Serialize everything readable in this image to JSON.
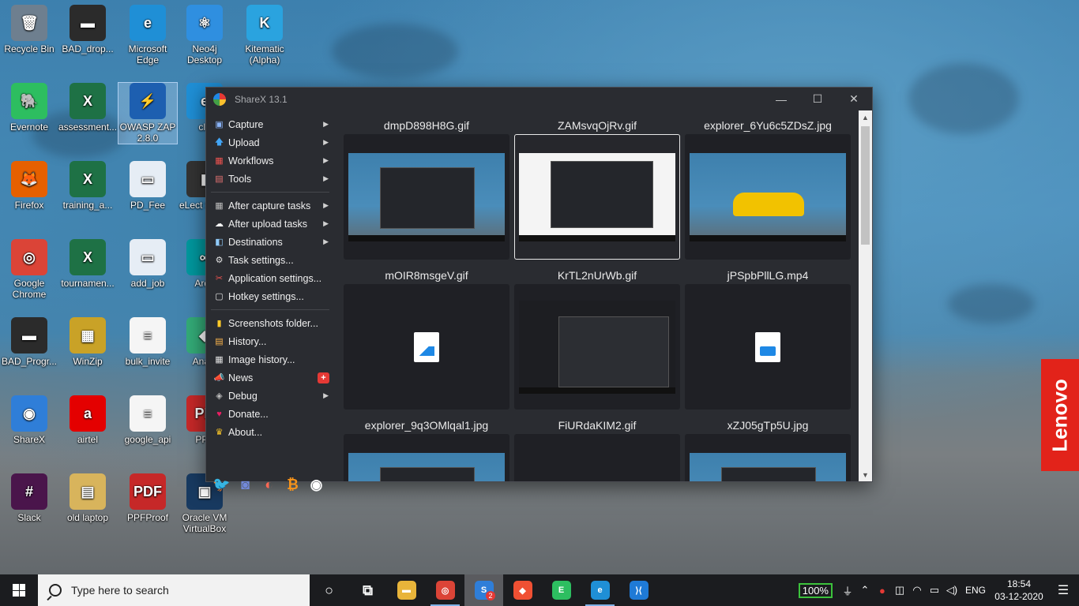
{
  "desktop": {
    "icons": [
      {
        "label": "Recycle Bin",
        "color": "#6e7f8f",
        "glyph": "🗑"
      },
      {
        "label": "BAD_drop...",
        "color": "#2b2b2b",
        "glyph": "▬"
      },
      {
        "label": "Microsoft Edge",
        "color": "#1f8fd6",
        "glyph": "e"
      },
      {
        "label": "Neo4j Desktop",
        "color": "#2f8fe0",
        "glyph": "⚛"
      },
      {
        "label": "Kitematic (Alpha)",
        "color": "#2aa3df",
        "glyph": "K"
      },
      {
        "label": "Evernote",
        "color": "#2dbe60",
        "glyph": "🐘"
      },
      {
        "label": "assessment...",
        "color": "#1e7145",
        "glyph": "X"
      },
      {
        "label": "OWASP ZAP 2.8.0",
        "color": "#1d5fb0",
        "glyph": "⚡"
      },
      {
        "label": "cla",
        "color": "#1f8fd6",
        "glyph": "e"
      },
      {
        "label": "Firefox",
        "color": "#e66000",
        "glyph": "🦊"
      },
      {
        "label": "training_a...",
        "color": "#1e7145",
        "glyph": "X"
      },
      {
        "label": "PD_Fee",
        "color": "#e6edf5",
        "glyph": "▭"
      },
      {
        "label": "eLect Scree",
        "color": "#333",
        "glyph": "▮"
      },
      {
        "label": "Google Chrome",
        "color": "#db4437",
        "glyph": "◎"
      },
      {
        "label": "tournamen...",
        "color": "#1e7145",
        "glyph": "X"
      },
      {
        "label": "add_job",
        "color": "#e6edf5",
        "glyph": "▭"
      },
      {
        "label": "Ardu",
        "color": "#00979d",
        "glyph": "∞"
      },
      {
        "label": "BAD_Progr...",
        "color": "#2b2b2b",
        "glyph": "▬"
      },
      {
        "label": "WinZip",
        "color": "#c9a227",
        "glyph": "▦"
      },
      {
        "label": "bulk_invite",
        "color": "#f5f5f5",
        "glyph": "≡"
      },
      {
        "label": "Analo",
        "color": "#3a7",
        "glyph": "◆"
      },
      {
        "label": "ShareX",
        "color": "#2f7ed8",
        "glyph": "◉"
      },
      {
        "label": "airtel",
        "color": "#e40000",
        "glyph": "a"
      },
      {
        "label": "google_api",
        "color": "#f5f5f5",
        "glyph": "≡"
      },
      {
        "label": "PPF",
        "color": "#c62828",
        "glyph": "PD"
      },
      {
        "label": "Slack",
        "color": "#4a154b",
        "glyph": "#"
      },
      {
        "label": "old laptop",
        "color": "#d8b45c",
        "glyph": "▤"
      },
      {
        "label": "PPFProof",
        "color": "#c62828",
        "glyph": "PDF"
      },
      {
        "label": "Oracle VM VirtualBox",
        "color": "#183a61",
        "glyph": "▣"
      }
    ]
  },
  "sharex": {
    "title": "ShareX 13.1",
    "controls": {
      "minimize": "—",
      "maximize": "☐",
      "close": "✕"
    },
    "menu_top": [
      {
        "label": "Capture",
        "icon": "▣",
        "color": "#8ab4f8",
        "submenu": true
      },
      {
        "label": "Upload",
        "icon": "🡅",
        "color": "#42a5f5",
        "submenu": true
      },
      {
        "label": "Workflows",
        "icon": "▦",
        "color": "#ef5350",
        "submenu": true
      },
      {
        "label": "Tools",
        "icon": "▤",
        "color": "#e57373",
        "submenu": true
      }
    ],
    "menu_mid": [
      {
        "label": "After capture tasks",
        "icon": "▦",
        "color": "#bdbdbd",
        "submenu": true
      },
      {
        "label": "After upload tasks",
        "icon": "☁",
        "color": "#ffffff",
        "submenu": true
      },
      {
        "label": "Destinations",
        "icon": "◧",
        "color": "#90caf9",
        "submenu": true
      },
      {
        "label": "Task settings...",
        "icon": "⚙",
        "color": "#e0e0e0",
        "submenu": false
      },
      {
        "label": "Application settings...",
        "icon": "✂",
        "color": "#ef5350",
        "submenu": false
      },
      {
        "label": "Hotkey settings...",
        "icon": "▢",
        "color": "#e0e0e0",
        "submenu": false
      }
    ],
    "menu_bottom": [
      {
        "label": "Screenshots folder...",
        "icon": "▮",
        "color": "#ffca28",
        "submenu": false
      },
      {
        "label": "History...",
        "icon": "▤",
        "color": "#ffb74d",
        "submenu": false
      },
      {
        "label": "Image history...",
        "icon": "▦",
        "color": "#e0e0e0",
        "submenu": false
      },
      {
        "label": "News",
        "icon": "📣",
        "color": "#ef5350",
        "submenu": false,
        "badge": "+"
      },
      {
        "label": "Debug",
        "icon": "◈",
        "color": "#bdbdbd",
        "submenu": true
      },
      {
        "label": "Donate...",
        "icon": "♥",
        "color": "#e91e63",
        "submenu": false
      },
      {
        "label": "About...",
        "icon": "♛",
        "color": "#ffca28",
        "submenu": false
      }
    ],
    "social": [
      {
        "name": "twitter-icon",
        "glyph": "🐦",
        "color": "#1da1f2"
      },
      {
        "name": "discord-icon",
        "glyph": "◙",
        "color": "#7289da"
      },
      {
        "name": "patreon-icon",
        "glyph": "◐",
        "color": "#f96854"
      },
      {
        "name": "bitcoin-icon",
        "glyph": "₿",
        "color": "#f7931a"
      },
      {
        "name": "github-icon",
        "glyph": "◉",
        "color": "#ffffff"
      }
    ],
    "gallery": [
      {
        "name": "dmpD898H8G.gif",
        "kind": "desk"
      },
      {
        "name": "ZAMsvqOjRv.gif",
        "kind": "white",
        "selected": true
      },
      {
        "name": "explorer_6Yu6c5ZDsZ.jpg",
        "kind": "car"
      },
      {
        "name": "mOIR8msgeV.gif",
        "kind": "file-image"
      },
      {
        "name": "KrTL2nUrWb.gif",
        "kind": "dark"
      },
      {
        "name": "jPSpbPllLG.mp4",
        "kind": "file-video"
      },
      {
        "name": "explorer_9q3OMlqal1.jpg",
        "kind": "desk"
      },
      {
        "name": "FiURdaKIM2.gif",
        "kind": "empty"
      },
      {
        "name": "xZJ05gTp5U.jpg",
        "kind": "desk"
      }
    ]
  },
  "lenovo": {
    "brand": "Lenovo"
  },
  "taskbar": {
    "search_placeholder": "Type here to search",
    "apps": [
      {
        "name": "cortana-icon",
        "glyph": "○",
        "color": "transparent"
      },
      {
        "name": "task-view-icon",
        "glyph": "⧉",
        "color": "transparent"
      },
      {
        "name": "file-explorer-icon",
        "glyph": "▬",
        "color": "#e8b43a"
      },
      {
        "name": "chrome-taskbar-icon",
        "glyph": "◎",
        "color": "#db4437",
        "running": true
      },
      {
        "name": "sharex-taskbar-icon",
        "glyph": "S",
        "color": "#2f7ed8",
        "active": true,
        "badge": "2"
      },
      {
        "name": "git-icon",
        "glyph": "◆",
        "color": "#f05033"
      },
      {
        "name": "evernote-taskbar-icon",
        "glyph": "E",
        "color": "#2dbe60"
      },
      {
        "name": "edge-taskbar-icon",
        "glyph": "e",
        "color": "#1f8fd6",
        "running": true
      },
      {
        "name": "vscode-icon",
        "glyph": "⟩⟨",
        "color": "#1f7ad6"
      }
    ],
    "battery": "100%",
    "language": "ENG",
    "time": "18:54",
    "date": "03-12-2020"
  }
}
